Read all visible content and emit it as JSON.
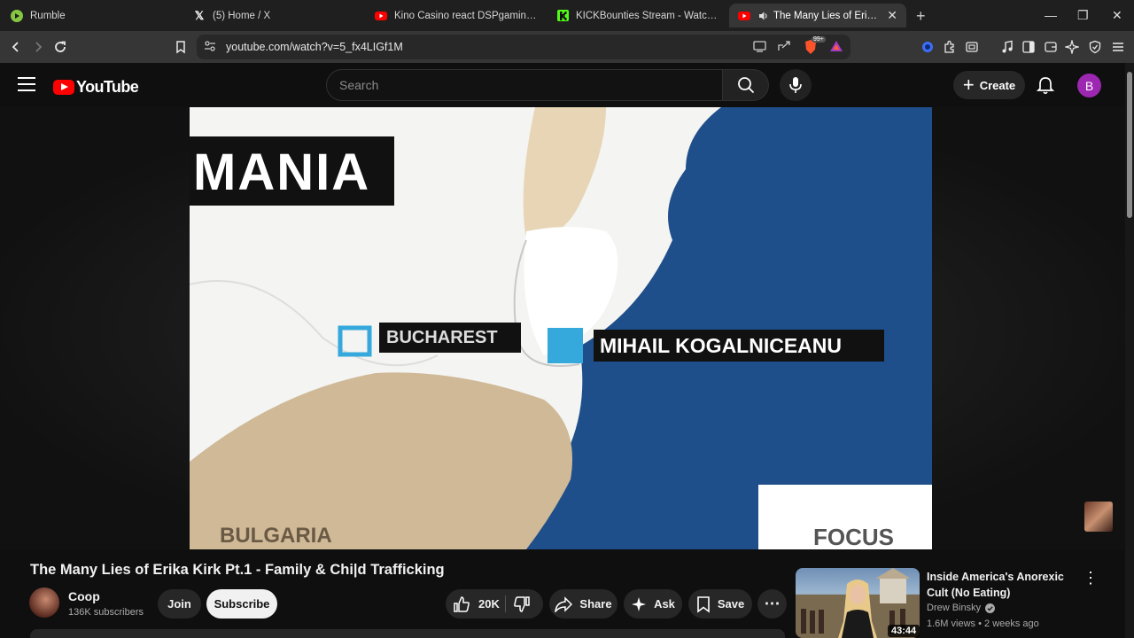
{
  "browser": {
    "tabs": [
      {
        "label": "Rumble",
        "icon": "rumble-icon"
      },
      {
        "label": "(5) Home / X",
        "icon": "x-icon"
      },
      {
        "label": "Kino Casino react DSPgamings W",
        "icon": "youtube-icon"
      },
      {
        "label": "KICKBounties Stream - Watch Live on",
        "icon": "kick-icon"
      },
      {
        "label": "The Many Lies of Erika Kirk Pt",
        "icon": "youtube-icon",
        "active": true,
        "audio": true
      }
    ],
    "url": "youtube.com/watch?v=5_fx4LIGf1M",
    "brave_badge": "99+"
  },
  "youtube": {
    "logo_text": "YouTube",
    "search_placeholder": "Search",
    "create_label": "Create",
    "avatar_letter": "B"
  },
  "video_frame": {
    "labels": {
      "country": "MANIA",
      "city": "BUCHAREST",
      "base": "MIHAIL KOGALNICEANU",
      "south": "BULGARIA",
      "corner": "FOCUS"
    }
  },
  "video": {
    "title": "The Many Lies of Erika Kirk Pt.1 - Family & Chi|d Trafficking",
    "channel": "Coop",
    "subscribers": "136K subscribers",
    "join_label": "Join",
    "subscribe_label": "Subscribe",
    "likes": "20K",
    "share_label": "Share",
    "ask_label": "Ask",
    "save_label": "Save"
  },
  "recommendation": {
    "title": "Inside America's Anorexic Cult (No Eating)",
    "channel": "Drew Binsky",
    "views": "1.6M views",
    "age": "2 weeks ago",
    "duration": "43:44"
  },
  "colors": {
    "brand_red": "#ff0000",
    "sea_blue": "#1f4f8a",
    "marker_cyan": "#35a9dc",
    "avatar_purple": "#9c27b0"
  }
}
